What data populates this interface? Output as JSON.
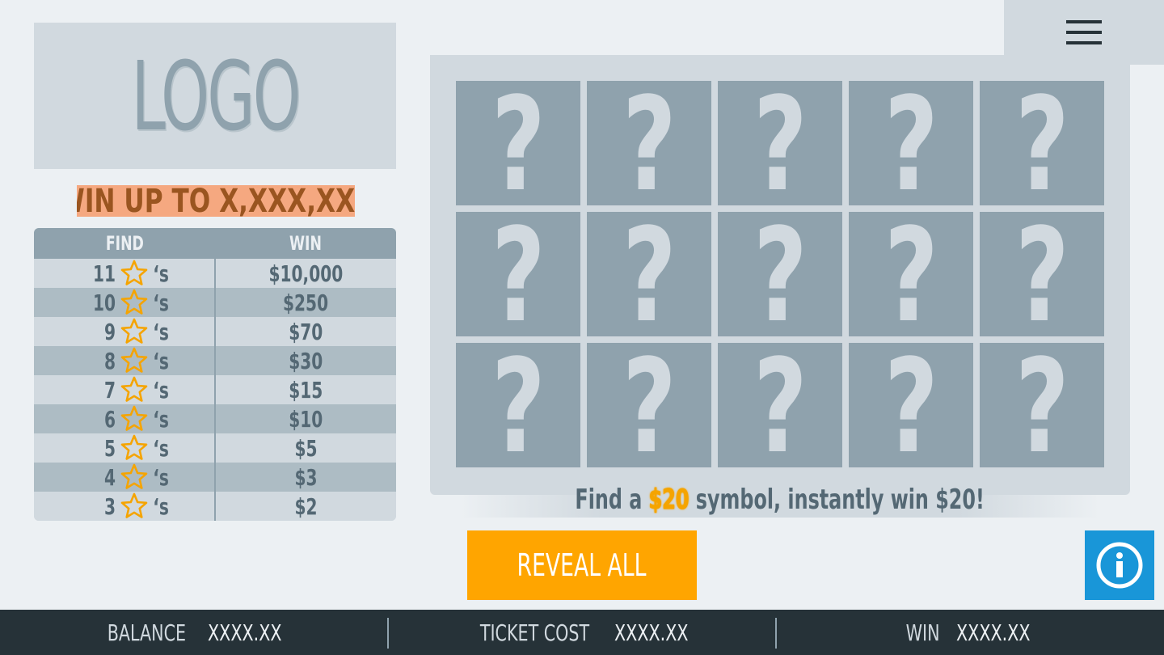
{
  "logo": {
    "text": "LOGO"
  },
  "banner": {
    "text": "WIN UP TO X,XXX,XXX"
  },
  "paytable": {
    "headers": {
      "find": "FIND",
      "win": "WIN"
    },
    "suffix": "‘s",
    "rows": [
      {
        "count": "11",
        "prize": "$10,000"
      },
      {
        "count": "10",
        "prize": "$250"
      },
      {
        "count": "9",
        "prize": "$70"
      },
      {
        "count": "8",
        "prize": "$30"
      },
      {
        "count": "7",
        "prize": "$15"
      },
      {
        "count": "6",
        "prize": "$10"
      },
      {
        "count": "5",
        "prize": "$5"
      },
      {
        "count": "4",
        "prize": "$3"
      },
      {
        "count": "3",
        "prize": "$2"
      }
    ]
  },
  "board": {
    "tile_symbol": "?",
    "rows": 3,
    "cols": 5
  },
  "hint": {
    "before": "Find a ",
    "highlight": "$20",
    "after": " symbol, instantly win $20!"
  },
  "reveal_button": {
    "label": "REVEAL ALL"
  },
  "footer": {
    "balance_label": "BALANCE",
    "balance_value": "XXXX.XX",
    "ticket_label": "TICKET COST",
    "ticket_value": "XXXX.XX",
    "win_label": "WIN",
    "win_value": "XXXX.XX"
  },
  "colors": {
    "background": "#ecf0f3",
    "panel": "#d1d9df",
    "tile": "#8fa2ad",
    "accent": "#ffa500",
    "info": "#1996d8",
    "footer": "#263238",
    "banner": "#f5a880",
    "star": "#f5a400"
  },
  "icons": {
    "menu": "hamburger-menu-icon",
    "info": "info-icon",
    "star": "star-icon"
  }
}
